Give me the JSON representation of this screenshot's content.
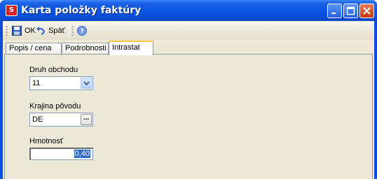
{
  "window": {
    "title": "Karta položky faktúry",
    "app_icon": "app-logo-icon",
    "controls": [
      "minimize",
      "maximize",
      "close"
    ]
  },
  "toolbar": {
    "ok_label": "OK",
    "back_label": "Späť",
    "help_icon": "help-icon"
  },
  "tabs": [
    {
      "label": "Popis / cena",
      "active": false
    },
    {
      "label": "Podrobnosti",
      "active": false
    },
    {
      "label": "Intrastat",
      "active": true
    }
  ],
  "form": {
    "druh_obchodu": {
      "label": "Druh obchodu",
      "value": "11"
    },
    "krajina_povodu": {
      "label": "Krajina pôvodu",
      "value": "DE",
      "button": "..."
    },
    "hmotnost": {
      "label": "Hmotnosť",
      "value": "0,40"
    }
  },
  "colors": {
    "titlebar": "#0b4fd8",
    "active_tab_highlight": "#ffc83c",
    "selection": "#316ac5"
  }
}
